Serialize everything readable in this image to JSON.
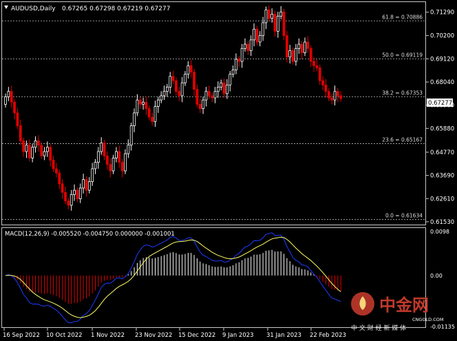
{
  "window": {
    "symbol_title": "AUDUSD,Daily",
    "ohlc": "0.67265 0.67298 0.67219 0.67277"
  },
  "colors": {
    "bull": "#ffffff",
    "bear": "#e00000",
    "macd_line": "#ffff66",
    "signal_line": "#1e3cff",
    "grid": "#bbbbbb",
    "price_tag_bg": "#ffffff",
    "watermark": "#c0392b"
  },
  "price_axis": {
    "labels": [
      "0.71290",
      "0.70200",
      "0.69120",
      "0.68040",
      "0.66960",
      "0.65880",
      "0.64770",
      "0.63690",
      "0.62610",
      "0.61530"
    ],
    "range": [
      0.614,
      0.716
    ]
  },
  "current_price": "0.67277",
  "fibonacci": [
    {
      "label": "61.8 = 0.70886",
      "value": 0.70886
    },
    {
      "label": "50.0 = 0.69119",
      "value": 0.69119
    },
    {
      "label": "38.2 = 0.67353",
      "value": 0.67353
    },
    {
      "label": "23.6 = 0.65167",
      "value": 0.65167
    },
    {
      "label": "0.0 = 0.61634",
      "value": 0.61634
    }
  ],
  "macd": {
    "title": "MACD(12,26,9) -0.005520 -0.004750 0.000000 -0.001001",
    "axis_labels": [
      "0.0098",
      "0.00",
      "-0.01135"
    ],
    "range": [
      -0.01135,
      0.0098
    ]
  },
  "date_axis": [
    "16 Sep 2022",
    "10 Oct 2022",
    "1 Nov 2022",
    "23 Nov 2022",
    "15 Dec 2022",
    "9 Jan 2023",
    "31 Jan 2023",
    "22 Feb 2023"
  ],
  "watermark": {
    "brand": "中金网",
    "sub": "中 文 财 经 新 媒 体",
    "domain": "CNGOLD.COM"
  },
  "chart_data": {
    "type": "candlestick",
    "close": [
      0.6735,
      0.676,
      0.671,
      0.666,
      0.66,
      0.653,
      0.648,
      0.651,
      0.645,
      0.65,
      0.653,
      0.651,
      0.646,
      0.648,
      0.65,
      0.644,
      0.64,
      0.638,
      0.633,
      0.629,
      0.625,
      0.623,
      0.628,
      0.63,
      0.626,
      0.631,
      0.635,
      0.63,
      0.634,
      0.64,
      0.643,
      0.648,
      0.652,
      0.646,
      0.642,
      0.639,
      0.645,
      0.648,
      0.643,
      0.639,
      0.647,
      0.651,
      0.66,
      0.666,
      0.672,
      0.67,
      0.671,
      0.668,
      0.664,
      0.662,
      0.669,
      0.672,
      0.674,
      0.676,
      0.678,
      0.683,
      0.681,
      0.676,
      0.674,
      0.68,
      0.684,
      0.688,
      0.685,
      0.677,
      0.67,
      0.668,
      0.672,
      0.676,
      0.674,
      0.673,
      0.676,
      0.678,
      0.68,
      0.675,
      0.679,
      0.684,
      0.686,
      0.691,
      0.69,
      0.696,
      0.698,
      0.695,
      0.7,
      0.705,
      0.699,
      0.702,
      0.708,
      0.714,
      0.71,
      0.712,
      0.704,
      0.711,
      0.713,
      0.702,
      0.692,
      0.695,
      0.69,
      0.696,
      0.698,
      0.694,
      0.699,
      0.696,
      0.69,
      0.688,
      0.687,
      0.681,
      0.679,
      0.676,
      0.673,
      0.672,
      0.676,
      0.674,
      0.6727
    ]
  }
}
